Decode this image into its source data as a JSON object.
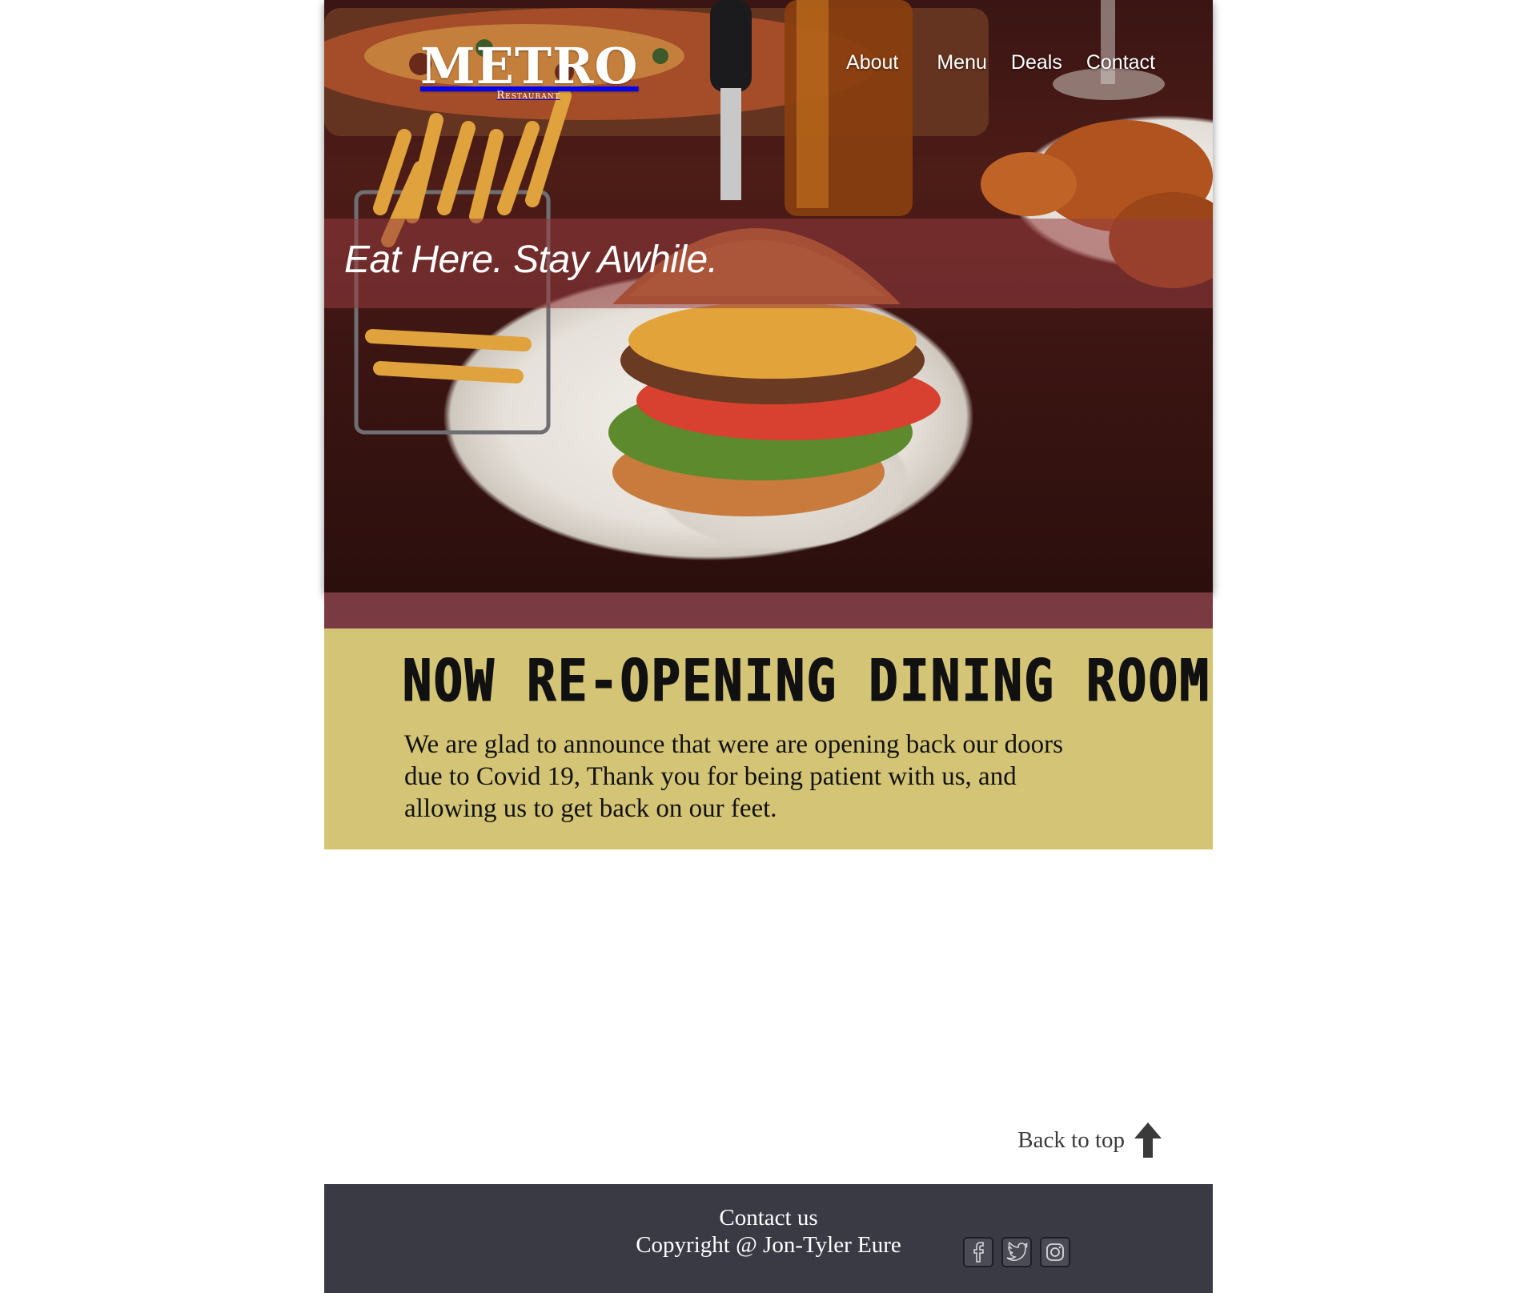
{
  "brand": {
    "name": "METRO",
    "subtitle": "Restaurant"
  },
  "nav": {
    "items": [
      "About",
      "Menu",
      "Deals",
      "Contact"
    ]
  },
  "hero": {
    "tagline": "Eat Here. Stay Awhile."
  },
  "announcement": {
    "title": "NOW RE-OPENING DINING ROOM",
    "body": "We are glad to announce that were are opening back our doors due to Covid 19, Thank you for being patient with us, and allowing us to get back on our feet."
  },
  "back_to_top": {
    "label": "Back to top",
    "icon": "arrow-up-icon"
  },
  "footer": {
    "contact": "Contact us",
    "copyright": "Copyright @ Jon-Tyler Eure",
    "socials": [
      "facebook-icon",
      "twitter-icon",
      "instagram-icon"
    ]
  },
  "colors": {
    "tagline_band": "#963c3e",
    "maroon_strip": "#7a3a41",
    "announcement_bg": "#d4c475",
    "footer_bg": "#393a44",
    "back_top_text": "#3a3a3a"
  }
}
